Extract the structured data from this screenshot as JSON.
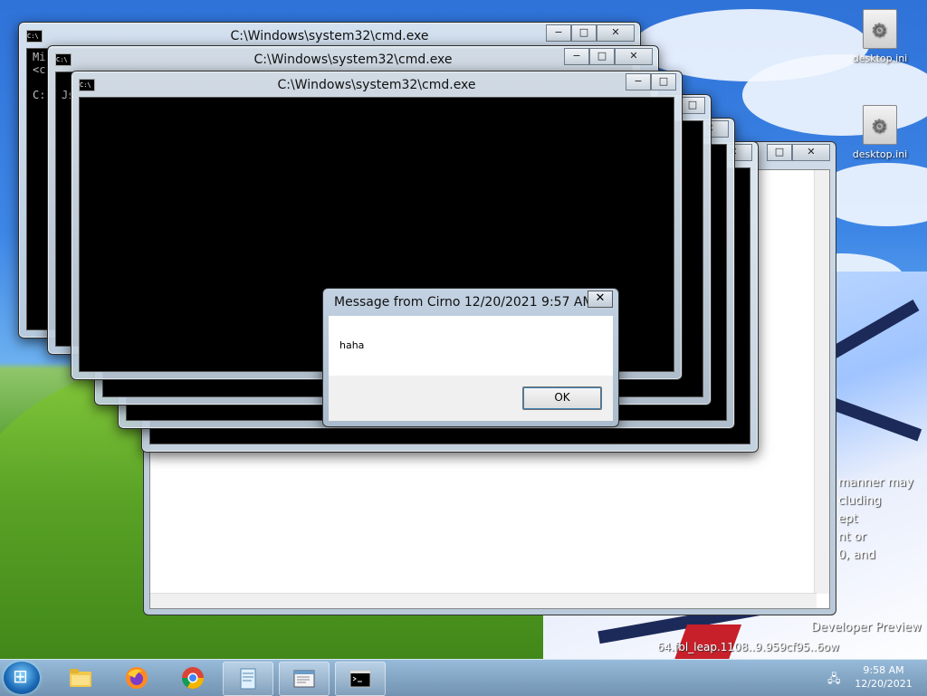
{
  "desktop": {
    "icons": [
      {
        "label": "desktop.ini"
      },
      {
        "label": "desktop.ini"
      }
    ],
    "overlay_lines": [
      "manner may",
      "cluding",
      "ept",
      "nt or",
      "0, and"
    ],
    "developer_text": "Developer Preview",
    "build_text": "64.fbl_leap.1108..9.959cf95..6ow"
  },
  "cmd_windows": [
    {
      "title": "C:\\Windows\\system32\\cmd.exe",
      "console": [
        "Mi",
        "<c",
        "",
        "C:"
      ]
    },
    {
      "title": "C:\\Windows\\system32\\cmd.exe",
      "console": [
        "Js"
      ]
    },
    {
      "title": "C:\\Windows\\system32\\cmd.exe",
      "console": []
    }
  ],
  "window_controls": {
    "minimize": "−",
    "maximize": "□",
    "close": "✕"
  },
  "message_box": {
    "title": "Message from Cirno 12/20/2021 9:57 AM",
    "close": "✕",
    "text": "haha",
    "ok_label": "OK"
  },
  "taskbar": {
    "pinned": [
      {
        "name": "file-explorer"
      },
      {
        "name": "firefox"
      },
      {
        "name": "chrome"
      },
      {
        "name": "notepad-app"
      },
      {
        "name": "notepad-window"
      },
      {
        "name": "cmd-window"
      }
    ],
    "time": "9:58 AM",
    "date": "12/20/2021"
  },
  "colors": {
    "console_bg": "#000000",
    "taskbar": "#8aa9c2",
    "accent": "#3c7fb1"
  }
}
